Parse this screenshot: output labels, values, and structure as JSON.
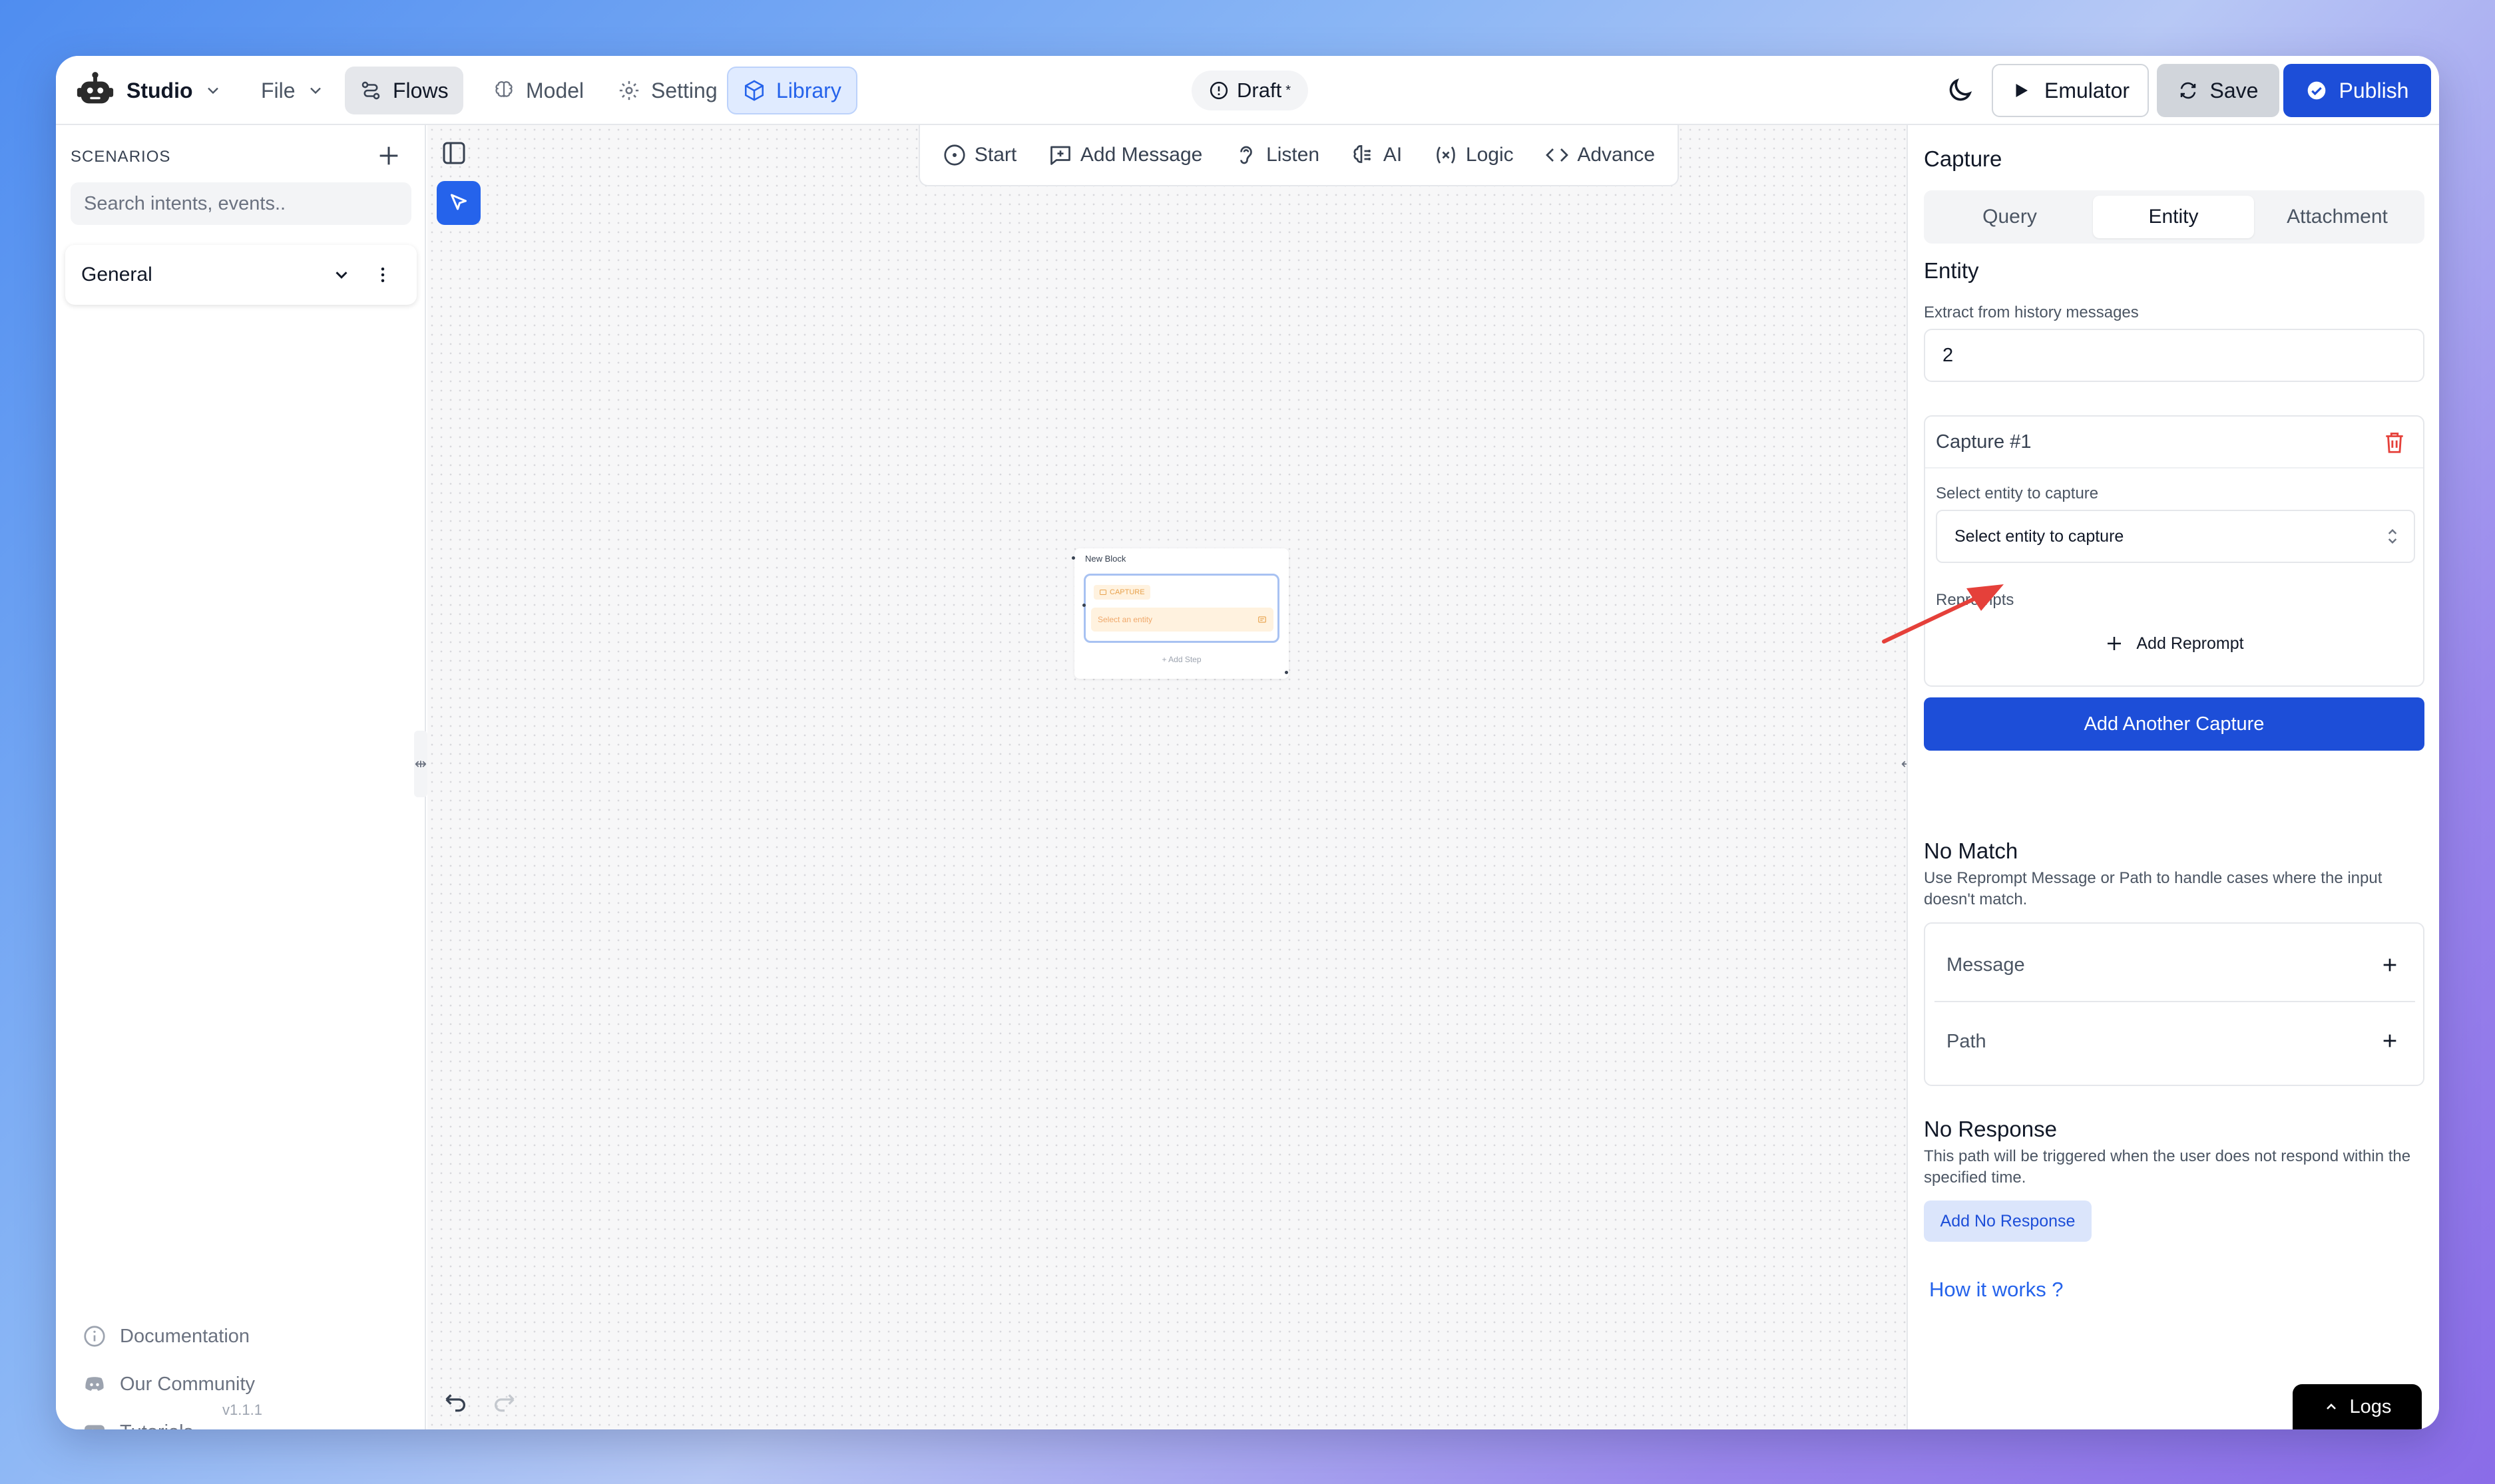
{
  "topbar": {
    "brand": "Studio",
    "file": "File",
    "flows": "Flows",
    "model": "Model",
    "setting": "Setting",
    "library": "Library",
    "draft": "Draft",
    "draft_mark": "*",
    "emulator": "Emulator",
    "save": "Save",
    "publish": "Publish"
  },
  "sidebar": {
    "heading": "SCENARIOS",
    "search_placeholder": "Search intents, events..",
    "general": "General",
    "links": [
      "Documentation",
      "Our Community",
      "Tutorials"
    ],
    "version": "v1.1.1"
  },
  "toolbar": {
    "items": [
      "Start",
      "Add Message",
      "Listen",
      "AI",
      "Logic",
      "Advance"
    ]
  },
  "node": {
    "title": "New Block",
    "tag": "CAPTURE",
    "field": "Select an entity",
    "add_step": "+ Add Step"
  },
  "panel": {
    "title": "Capture",
    "tabs": [
      "Query",
      "Entity",
      "Attachment"
    ],
    "active_tab": "Entity",
    "entity_heading": "Entity",
    "history_label": "Extract from history messages",
    "history_value": "2",
    "capture_title": "Capture #1",
    "select_label": "Select entity to capture",
    "select_value": "Select entity to capture",
    "reprompts_label": "Reprompts",
    "add_reprompt": "Add Reprompt",
    "add_another": "Add Another Capture",
    "no_match_title": "No Match",
    "no_match_desc": "Use Reprompt Message or Path to handle cases where the input doesn't match.",
    "message": "Message",
    "path": "Path",
    "no_response_title": "No Response",
    "no_response_desc": "This path will be triggered when the user does not respond within the specified time.",
    "add_no_response": "Add No Response",
    "how_it_works": "How it works ?"
  },
  "logs": "Logs",
  "colors": {
    "accent": "#1d4ed8",
    "library_bg": "#e0ebff",
    "capture_orange": "#e8a24d",
    "arrow_red": "#e5403a"
  }
}
